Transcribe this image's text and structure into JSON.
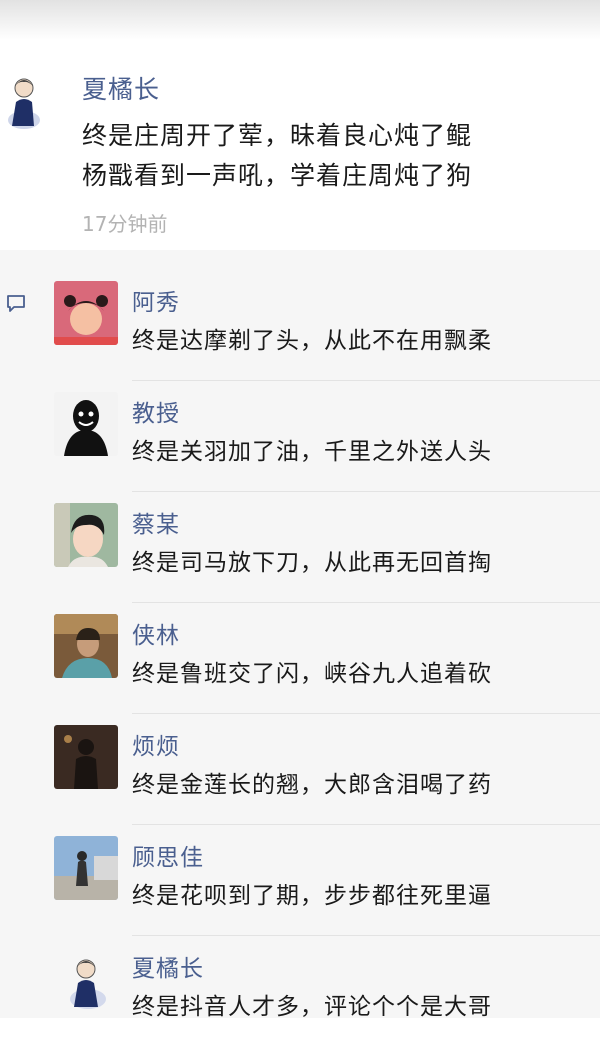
{
  "post": {
    "author": "夏橘长",
    "line1": "终是庄周开了荤，昧着良心炖了鲲",
    "line2": "杨戬看到一声吼，学着庄周炖了狗",
    "time": "17分钟前"
  },
  "comments": [
    {
      "name": "阿秀",
      "text": "终是达摩剃了头，从此不在用飘柔",
      "avatar": "girl-avatar"
    },
    {
      "name": "教授",
      "text": "终是关羽加了油，千里之外送人头",
      "avatar": "dark-figure-avatar"
    },
    {
      "name": "蔡某",
      "text": "终是司马放下刀，从此再无回首掏",
      "avatar": "cartoon-boy-avatar"
    },
    {
      "name": "侠林",
      "text": "终是鲁班交了闪，峡谷九人追着砍",
      "avatar": "man-photo-avatar"
    },
    {
      "name": "烦烦",
      "text": "终是金莲长的翘，大郎含泪喝了药",
      "avatar": "night-figure-avatar"
    },
    {
      "name": "顾思佳",
      "text": "终是花呗到了期，步步都往死里逼",
      "avatar": "street-photo-avatar"
    },
    {
      "name": "夏橘长",
      "text": "终是抖音人才多，评论个个是大哥",
      "avatar": "sketch-person-avatar"
    }
  ],
  "colors": {
    "name": "#4a5f8f",
    "text": "#1a1a1a",
    "time": "#b3b3b3",
    "comment_bg": "#f6f6f6"
  }
}
